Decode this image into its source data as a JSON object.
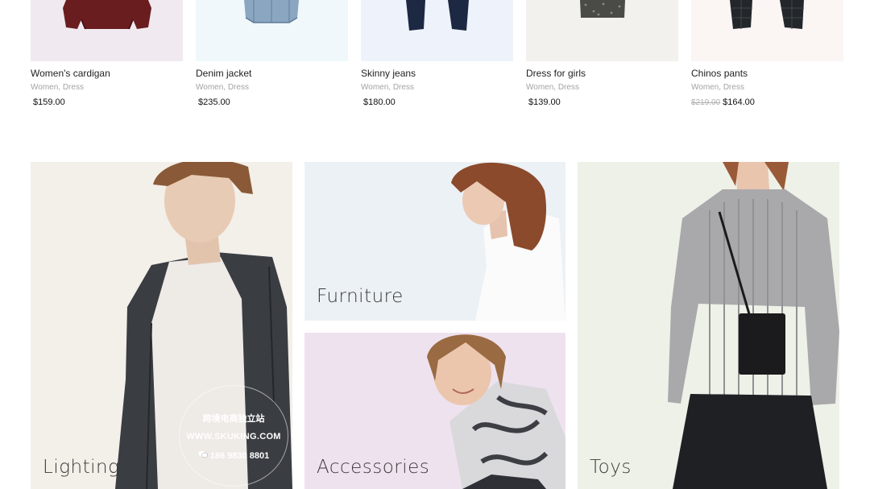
{
  "products": [
    {
      "name": "Women's cardigan",
      "category": "Women, Dress",
      "price": "$159.00",
      "old_price": "",
      "bg": "#f0eaf0",
      "garment_color": "#6a1d1f"
    },
    {
      "name": "Denim jacket",
      "category": "Women, Dress",
      "price": "$235.00",
      "old_price": "",
      "bg": "#f0f8fb",
      "garment_color": "#8aa4bf"
    },
    {
      "name": "Skinny jeans",
      "category": "Women, Dress",
      "price": "$180.00",
      "old_price": "",
      "bg": "#eef3fb",
      "garment_color": "#1d2843"
    },
    {
      "name": "Dress for girls",
      "category": "Women, Dress",
      "price": "$139.00",
      "old_price": "",
      "bg": "#f2f1ed",
      "garment_color": "#4a4a46"
    },
    {
      "name": "Chinos pants",
      "category": "Women, Dress",
      "price": "$164.00",
      "old_price": "$219.00",
      "bg": "#fbf5f4",
      "garment_color": "#23272b"
    }
  ],
  "categories": {
    "lighting": "Lighting",
    "furniture": "Furniture",
    "accessories": "Accessories",
    "toys": "Toys"
  },
  "watermark": {
    "line1": "跨境电商独立站",
    "line2": "WWW.SKUKING.COM",
    "line3": "186 9830 8801"
  }
}
